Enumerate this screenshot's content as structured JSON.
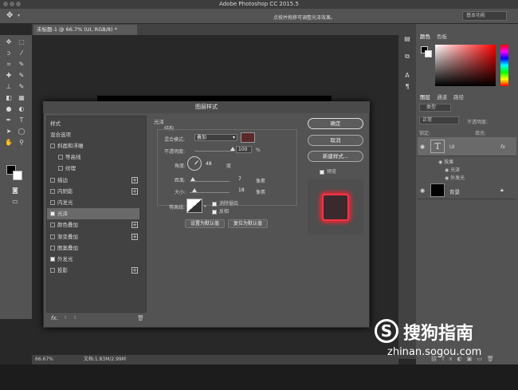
{
  "app": {
    "title": "Adobe Photoshop CC 2015.5"
  },
  "options_bar": {
    "hint": "点按并拖移可调整光泽效果。",
    "workspace": "基本功能"
  },
  "document": {
    "tab": "未标题-1 @ 66.7% (UI, RGB/8) *",
    "zoom": "66.67%",
    "doc_info": "文档:1.83M/2.99M"
  },
  "right_panel": {
    "color_tabs": [
      "颜色",
      "色板"
    ],
    "layer_tabs": [
      "图层",
      "通道",
      "路径"
    ],
    "filter_label": "类型",
    "blend_mode": "正常",
    "opacity_label": "不透明度:",
    "lock_label": "锁定:",
    "fill_label": "填充:",
    "layers": [
      {
        "name": "UI",
        "fx": "fx"
      },
      {
        "name": "效果"
      },
      {
        "name": "光泽"
      },
      {
        "name": "外发光"
      },
      {
        "name": "背景"
      }
    ]
  },
  "dialog": {
    "title": "图层样式",
    "left_list": {
      "header": "样式",
      "blend_options": "混合选项",
      "items": [
        {
          "label": "斜面和浮雕",
          "checked": false
        },
        {
          "label": "等高线",
          "checked": false
        },
        {
          "label": "纹理",
          "checked": false
        },
        {
          "label": "描边",
          "checked": false
        },
        {
          "label": "内阴影",
          "checked": false
        },
        {
          "label": "内发光",
          "checked": false
        },
        {
          "label": "光泽",
          "checked": true
        },
        {
          "label": "颜色叠加",
          "checked": false
        },
        {
          "label": "渐变叠加",
          "checked": false
        },
        {
          "label": "图案叠加",
          "checked": false
        },
        {
          "label": "外发光",
          "checked": true
        },
        {
          "label": "投影",
          "checked": false
        }
      ],
      "fx_label": "fx."
    },
    "section_title": "光泽",
    "section_sub": "结构",
    "blend_mode_label": "混合模式:",
    "blend_mode_value": "叠加",
    "glow_color": "#5a2a2a",
    "opacity_label": "不透明度:",
    "opacity_value": "100",
    "opacity_unit": "%",
    "angle_label": "角度:",
    "angle_value": "48",
    "angle_unit": "度",
    "distance_label": "距离:",
    "distance_value": "7",
    "distance_unit": "像素",
    "size_label": "大小:",
    "size_value": "18",
    "size_unit": "像素",
    "contour_label": "等高线:",
    "antialias_label": "消除锯齿",
    "antialias_checked": true,
    "invert_label": "反相",
    "invert_checked": true,
    "set_default": "设置为默认值",
    "reset_default": "复位为默认值",
    "ok": "确定",
    "cancel": "取消",
    "new_style": "新建样式...",
    "preview_label": "预览",
    "preview_checked": true
  },
  "watermark": {
    "brand": "搜狗指南",
    "url": "zhinan.sogou.com"
  }
}
